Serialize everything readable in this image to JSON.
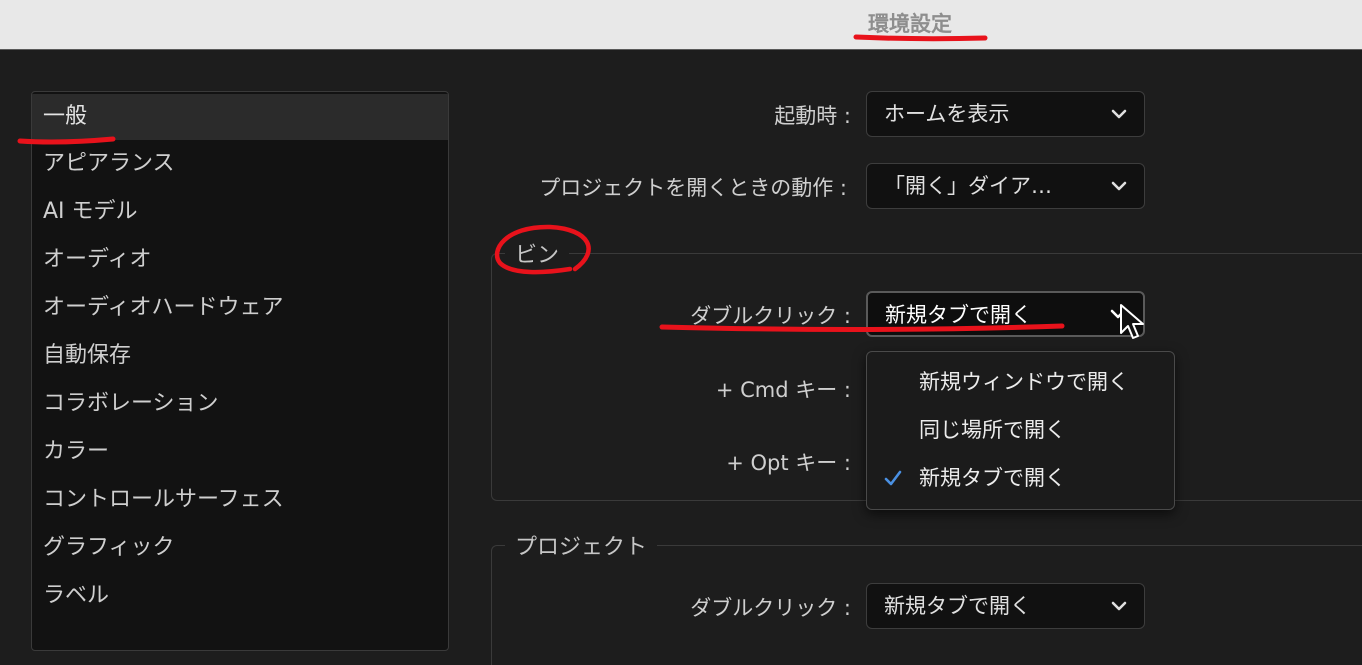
{
  "window": {
    "title": "環境設定"
  },
  "sidebar": {
    "items": [
      {
        "label": "一般",
        "selected": true
      },
      {
        "label": "アピアランス"
      },
      {
        "label": "AI モデル"
      },
      {
        "label": "オーディオ"
      },
      {
        "label": "オーディオハードウェア"
      },
      {
        "label": "自動保存"
      },
      {
        "label": "コラボレーション"
      },
      {
        "label": "カラー"
      },
      {
        "label": "コントロールサーフェス"
      },
      {
        "label": "グラフィック"
      },
      {
        "label": "ラベル"
      }
    ]
  },
  "general": {
    "startup_label": "起動時 :",
    "startup_value": "ホームを表示",
    "open_project_label": "プロジェクトを開くときの動作 :",
    "open_project_value": "「開く」ダイア…"
  },
  "bins": {
    "title": "ビン",
    "double_click_label": "ダブルクリック :",
    "double_click_value": "新規タブで開く",
    "cmd_label": "+ Cmd キー :",
    "opt_label": "+ Opt キー :"
  },
  "dropdown_menu": {
    "options": [
      {
        "label": "新規ウィンドウで開く",
        "checked": false
      },
      {
        "label": "同じ場所で開く",
        "checked": false
      },
      {
        "label": "新規タブで開く",
        "checked": true
      }
    ]
  },
  "project": {
    "title": "プロジェクト",
    "double_click_label": "ダブルクリック :",
    "double_click_value": "新規タブで開く"
  },
  "colors": {
    "annotation": "#e8121b",
    "check": "#4a90e2"
  }
}
